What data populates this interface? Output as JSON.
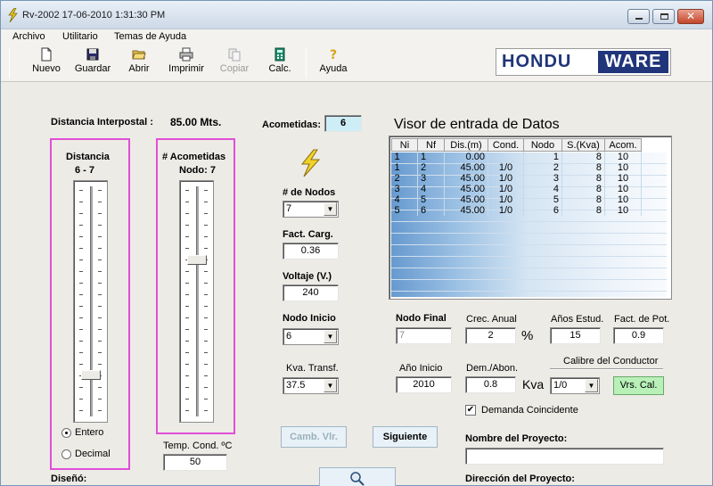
{
  "window": {
    "title": "Rv-2002  17-06-2010  1:31:30 PM"
  },
  "menu": [
    "Archivo",
    "Utilitario",
    "Temas de Ayuda"
  ],
  "toolbar": {
    "nuevo": "Nuevo",
    "guardar": "Guardar",
    "abrir": "Abrir",
    "imprimir": "Imprimir",
    "copiar": "Copiar",
    "calc": "Calc.",
    "ayuda": "Ayuda"
  },
  "logo": {
    "part1": "HONDU",
    "part2": "WARE"
  },
  "interpostal": {
    "label": "Distancia Interpostal :",
    "value": "85.00 Mts."
  },
  "distancia": {
    "title": "Distancia",
    "range": "6  -  7",
    "level": 0.83
  },
  "acometidas_panel": {
    "title": "# Acometidas",
    "nodo": "Nodo:  7",
    "level": 0.31
  },
  "radio": {
    "entero": "Entero",
    "decimal": "Decimal"
  },
  "temp": {
    "label": "Temp. Cond. ºC",
    "value": "50"
  },
  "diseno": {
    "label": "Diseñó:"
  },
  "acometidas": {
    "label": "Acometidas:",
    "value": "6"
  },
  "nodos": {
    "label": "# de Nodos",
    "value": "7"
  },
  "fact_carg": {
    "label": "Fact. Carg.",
    "value": "0.36"
  },
  "voltaje": {
    "label": "Voltaje (V.)",
    "value": "240"
  },
  "nodo_inicio": {
    "label": "Nodo Inicio",
    "value": "6"
  },
  "kva_transf": {
    "label": "Kva. Transf.",
    "value": "37.5"
  },
  "buttons": {
    "camb": "Camb. Vlr.",
    "siguiente": "Siguiente",
    "vrs": "Vrs. Cal."
  },
  "visor": {
    "title": "Visor  de entrada de Datos",
    "columns": [
      "Ni",
      "Nf",
      "Dis.(m)",
      "Cond.",
      "Nodo",
      "S.(Kva)",
      "Acom."
    ],
    "rows": [
      [
        "1",
        "1",
        "0.00",
        "",
        "1",
        "8",
        "10"
      ],
      [
        "1",
        "2",
        "45.00",
        "1/0",
        "2",
        "8",
        "10"
      ],
      [
        "2",
        "3",
        "45.00",
        "1/0",
        "3",
        "8",
        "10"
      ],
      [
        "3",
        "4",
        "45.00",
        "1/0",
        "4",
        "8",
        "10"
      ],
      [
        "4",
        "5",
        "45.00",
        "1/0",
        "5",
        "8",
        "10"
      ],
      [
        "5",
        "6",
        "45.00",
        "1/0",
        "6",
        "8",
        "10"
      ]
    ]
  },
  "nodo_final": {
    "label": "Nodo Final",
    "value": "7"
  },
  "crec_anual": {
    "label": "Crec. Anual",
    "value": "2",
    "unit": "%"
  },
  "anos_estud": {
    "label": "Años Estud.",
    "value": "15"
  },
  "fact_pot": {
    "label": "Fact. de Pot.",
    "value": "0.9"
  },
  "ano_inicio": {
    "label": "Año Inicio",
    "value": "2010"
  },
  "dem_abon": {
    "label": "Dem./Abon.",
    "value": "0.8",
    "unit": "Kva"
  },
  "calibre": {
    "label": "Calibre del Conductor",
    "value": "1/0"
  },
  "demanda": {
    "label": "Demanda Coincidente",
    "checked": "✔"
  },
  "proyecto": {
    "nombre_label": "Nombre del Proyecto:",
    "nombre_value": "",
    "direccion_label": "Dirección del Proyecto:"
  }
}
